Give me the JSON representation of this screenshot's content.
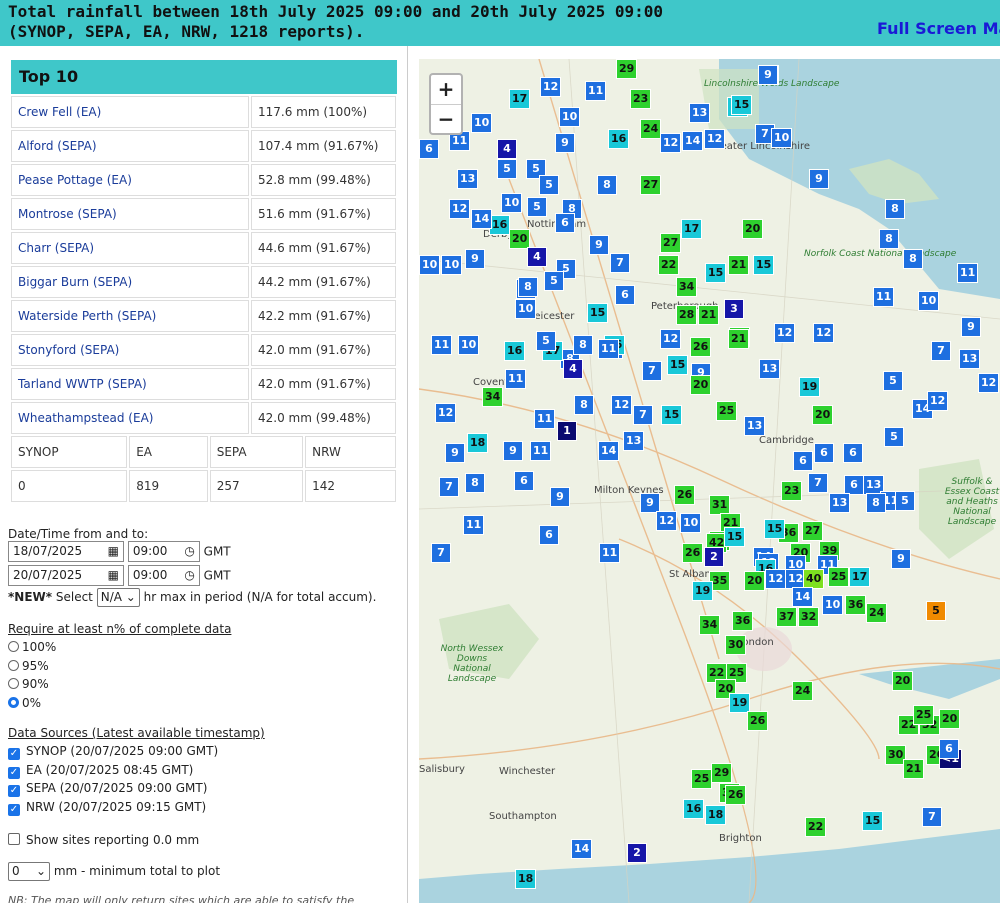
{
  "header": {
    "title_line1": "Total rainfall between 18th July 2025 09:00 and 20th July 2025 09:00",
    "title_line2": "(SYNOP, SEPA, EA, NRW, 1218 reports).",
    "full_screen": "Full Screen Ma"
  },
  "top10": {
    "heading": "Top 10",
    "rows": [
      {
        "site": "Crew Fell (EA)",
        "value": "117.6 mm (100%)"
      },
      {
        "site": "Alford (SEPA)",
        "value": "107.4 mm (91.67%)"
      },
      {
        "site": "Pease Pottage (EA)",
        "value": "52.8 mm (99.48%)"
      },
      {
        "site": "Montrose (SEPA)",
        "value": "51.6 mm (91.67%)"
      },
      {
        "site": "Charr (SEPA)",
        "value": "44.6 mm (91.67%)"
      },
      {
        "site": "Biggar Burn (SEPA)",
        "value": "44.2 mm (91.67%)"
      },
      {
        "site": "Waterside Perth (SEPA)",
        "value": "42.2 mm (91.67%)"
      },
      {
        "site": "Stonyford (SEPA)",
        "value": "42.0 mm (91.67%)"
      },
      {
        "site": "Tarland WWTP (SEPA)",
        "value": "42.0 mm (91.67%)"
      },
      {
        "site": "Wheathampstead (EA)",
        "value": "42.0 mm (99.48%)"
      }
    ],
    "count_headers": [
      "SYNOP",
      "EA",
      "SEPA",
      "NRW"
    ],
    "count_values": [
      "0",
      "819",
      "257",
      "142"
    ]
  },
  "form": {
    "datetime_label": "Date/Time from and to:",
    "from_date": "18/07/2025",
    "from_time": "09:00",
    "to_date": "20/07/2025",
    "to_time": "09:00",
    "gmt": "GMT",
    "new_prefix": "*NEW*",
    "select_label": "Select",
    "hr_select": "N/A",
    "hr_suffix": "hr max in period (N/A for total accum).",
    "require_label": "Require at least n% of complete data",
    "radio_options": [
      "100%",
      "95%",
      "90%",
      "0%"
    ],
    "radio_selected": "0%",
    "sources_label": "Data Sources (Latest available timestamp)",
    "sources": [
      "SYNOP (20/07/2025 09:00 GMT)",
      "EA (20/07/2025 08:45 GMT)",
      "SEPA (20/07/2025 09:00 GMT)",
      "NRW (20/07/2025 09:15 GMT)"
    ],
    "show_zero_label": "Show sites reporting 0.0 mm",
    "min_total_select": "0",
    "min_total_label": "mm - minimum total to plot",
    "note_fragment": "NB: The map will only return sites which are able to satisfy the"
  },
  "map": {
    "zoom_in": "+",
    "zoom_out": "−",
    "places": [
      "Lincolnshire Wolds Landscape",
      "Greater Lincolnshire",
      "Nottingham",
      "Derby",
      "Leicester",
      "Peterborough",
      "Norfolk Coast National Landscape",
      "Coventry",
      "Cambridge",
      "Milton Keynes",
      "St Albans",
      "London",
      "North Wessex Downs National Landscape",
      "Salisbury",
      "Winchester",
      "Southampton",
      "Brighton",
      "Suffolk & Essex Coast and Heaths National Landscape"
    ],
    "colors": {
      "low": "#1e6fe0",
      "mid": "#1a9bd6",
      "cyan": "#19c8d8",
      "green": "#2ed12e",
      "lime": "#7ee020",
      "dark": "#1616a8",
      "orange": "#f08a00",
      "darkest": "#0a0a70"
    },
    "markers": [
      {
        "v": "29",
        "c": "green"
      },
      {
        "v": "9",
        "c": "low"
      },
      {
        "v": "17",
        "c": "cyan"
      },
      {
        "v": "12",
        "c": "low"
      },
      {
        "v": "11",
        "c": "low"
      },
      {
        "v": "23",
        "c": "green"
      },
      {
        "v": "13",
        "c": "low"
      },
      {
        "v": "15",
        "c": "cyan"
      },
      {
        "v": "9",
        "c": "low"
      },
      {
        "v": "10",
        "c": "low"
      },
      {
        "v": "10",
        "c": "low"
      },
      {
        "v": "24",
        "c": "green"
      },
      {
        "v": "12",
        "c": "low"
      },
      {
        "v": "15",
        "c": "cyan"
      },
      {
        "v": "7",
        "c": "low"
      },
      {
        "v": "10",
        "c": "low"
      },
      {
        "v": "6",
        "c": "low"
      },
      {
        "v": "11",
        "c": "low"
      },
      {
        "v": "4",
        "c": "dark"
      },
      {
        "v": "9",
        "c": "low"
      },
      {
        "v": "16",
        "c": "cyan"
      },
      {
        "v": "14",
        "c": "low"
      },
      {
        "v": "12",
        "c": "low"
      },
      {
        "v": "5",
        "c": "low"
      },
      {
        "v": "5",
        "c": "low"
      },
      {
        "v": "13",
        "c": "low"
      },
      {
        "v": "5",
        "c": "low"
      },
      {
        "v": "8",
        "c": "low"
      },
      {
        "v": "27",
        "c": "green"
      },
      {
        "v": "9",
        "c": "low"
      },
      {
        "v": "12",
        "c": "low"
      },
      {
        "v": "10",
        "c": "low"
      },
      {
        "v": "5",
        "c": "low"
      },
      {
        "v": "8",
        "c": "low"
      },
      {
        "v": "16",
        "c": "cyan"
      },
      {
        "v": "14",
        "c": "low"
      },
      {
        "v": "6",
        "c": "low"
      },
      {
        "v": "20",
        "c": "green"
      },
      {
        "v": "17",
        "c": "cyan"
      },
      {
        "v": "20",
        "c": "green"
      },
      {
        "v": "8",
        "c": "low"
      },
      {
        "v": "9",
        "c": "low"
      },
      {
        "v": "8",
        "c": "low"
      },
      {
        "v": "27",
        "c": "green"
      },
      {
        "v": "10",
        "c": "low"
      },
      {
        "v": "10",
        "c": "low"
      },
      {
        "v": "9",
        "c": "low"
      },
      {
        "v": "4",
        "c": "dark"
      },
      {
        "v": "5",
        "c": "low"
      },
      {
        "v": "7",
        "c": "low"
      },
      {
        "v": "22",
        "c": "green"
      },
      {
        "v": "15",
        "c": "cyan"
      },
      {
        "v": "21",
        "c": "green"
      },
      {
        "v": "15",
        "c": "cyan"
      },
      {
        "v": "8",
        "c": "low"
      },
      {
        "v": "11",
        "c": "low"
      },
      {
        "v": "6",
        "c": "low"
      },
      {
        "v": "5",
        "c": "low"
      },
      {
        "v": "34",
        "c": "green"
      },
      {
        "v": "11",
        "c": "low"
      },
      {
        "v": "10",
        "c": "low"
      },
      {
        "v": "10",
        "c": "low"
      },
      {
        "v": "8",
        "c": "low"
      },
      {
        "v": "15",
        "c": "cyan"
      },
      {
        "v": "6",
        "c": "low"
      },
      {
        "v": "28",
        "c": "green"
      },
      {
        "v": "21",
        "c": "green"
      },
      {
        "v": "3",
        "c": "dark"
      },
      {
        "v": "9",
        "c": "low"
      },
      {
        "v": "7",
        "c": "low"
      },
      {
        "v": "8",
        "c": "low"
      },
      {
        "v": "6",
        "c": "low"
      },
      {
        "v": "28",
        "c": "green"
      },
      {
        "v": "12",
        "c": "low"
      },
      {
        "v": "12",
        "c": "low"
      },
      {
        "v": "11",
        "c": "low"
      },
      {
        "v": "10",
        "c": "low"
      },
      {
        "v": "16",
        "c": "cyan"
      },
      {
        "v": "17",
        "c": "cyan"
      },
      {
        "v": "5",
        "c": "low"
      },
      {
        "v": "8",
        "c": "low"
      },
      {
        "v": "16",
        "c": "cyan"
      },
      {
        "v": "12",
        "c": "low"
      },
      {
        "v": "26",
        "c": "green"
      },
      {
        "v": "21",
        "c": "green"
      },
      {
        "v": "13",
        "c": "low"
      },
      {
        "v": "4",
        "c": "dark"
      },
      {
        "v": "11",
        "c": "low"
      },
      {
        "v": "7",
        "c": "low"
      },
      {
        "v": "15",
        "c": "cyan"
      },
      {
        "v": "9",
        "c": "low"
      },
      {
        "v": "13",
        "c": "low"
      },
      {
        "v": "3",
        "c": "dark"
      },
      {
        "v": "34",
        "c": "green"
      },
      {
        "v": "11",
        "c": "low"
      },
      {
        "v": "20",
        "c": "green"
      },
      {
        "v": "19",
        "c": "cyan"
      },
      {
        "v": "5",
        "c": "low"
      },
      {
        "v": "12",
        "c": "low"
      },
      {
        "v": "14",
        "c": "low"
      },
      {
        "v": "12",
        "c": "low"
      },
      {
        "v": "8",
        "c": "low"
      },
      {
        "v": "12",
        "c": "low"
      },
      {
        "v": "7",
        "c": "low"
      },
      {
        "v": "15",
        "c": "cyan"
      },
      {
        "v": "25",
        "c": "green"
      },
      {
        "v": "20",
        "c": "green"
      },
      {
        "v": "11",
        "c": "low"
      },
      {
        "v": "1",
        "c": "darkest"
      },
      {
        "v": "13",
        "c": "low"
      },
      {
        "v": "6",
        "c": "low"
      },
      {
        "v": "5",
        "c": "low"
      },
      {
        "v": "12",
        "c": "low"
      },
      {
        "v": "18",
        "c": "cyan"
      },
      {
        "v": "9",
        "c": "low"
      },
      {
        "v": "9",
        "c": "low"
      },
      {
        "v": "11",
        "c": "low"
      },
      {
        "v": "14",
        "c": "low"
      },
      {
        "v": "13",
        "c": "low"
      },
      {
        "v": "6",
        "c": "low"
      },
      {
        "v": "6",
        "c": "low"
      },
      {
        "v": "7",
        "c": "low"
      },
      {
        "v": "8",
        "c": "low"
      },
      {
        "v": "6",
        "c": "low"
      },
      {
        "v": "7",
        "c": "low"
      },
      {
        "v": "6",
        "c": "low"
      },
      {
        "v": "13",
        "c": "low"
      },
      {
        "v": "11",
        "c": "low"
      },
      {
        "v": "9",
        "c": "low"
      },
      {
        "v": "9",
        "c": "low"
      },
      {
        "v": "26",
        "c": "green"
      },
      {
        "v": "23",
        "c": "green"
      },
      {
        "v": "13",
        "c": "low"
      },
      {
        "v": "5",
        "c": "low"
      },
      {
        "v": "31",
        "c": "green"
      },
      {
        "v": "21",
        "c": "green"
      },
      {
        "v": "26",
        "c": "green"
      },
      {
        "v": "10",
        "c": "low"
      },
      {
        "v": "12",
        "c": "low"
      },
      {
        "v": "36",
        "c": "green"
      },
      {
        "v": "27",
        "c": "green"
      },
      {
        "v": "15",
        "c": "cyan"
      },
      {
        "v": "20",
        "c": "green"
      },
      {
        "v": "7",
        "c": "low"
      },
      {
        "v": "6",
        "c": "low"
      },
      {
        "v": "11",
        "c": "low"
      },
      {
        "v": "42",
        "c": "green"
      },
      {
        "v": "2",
        "c": "dark"
      },
      {
        "v": "15",
        "c": "cyan"
      },
      {
        "v": "10",
        "c": "low"
      },
      {
        "v": "8",
        "c": "low"
      },
      {
        "v": "9",
        "c": "low"
      },
      {
        "v": "39",
        "c": "green"
      },
      {
        "v": "26",
        "c": "green"
      },
      {
        "v": "14",
        "c": "low"
      },
      {
        "v": "12",
        "c": "low"
      },
      {
        "v": "16",
        "c": "cyan"
      },
      {
        "v": "11",
        "c": "low"
      },
      {
        "v": "11",
        "c": "low"
      },
      {
        "v": "35",
        "c": "green"
      },
      {
        "v": "20",
        "c": "green"
      },
      {
        "v": "12",
        "c": "low"
      },
      {
        "v": "12",
        "c": "low"
      },
      {
        "v": "40",
        "c": "lime"
      },
      {
        "v": "25",
        "c": "green"
      },
      {
        "v": "17",
        "c": "cyan"
      },
      {
        "v": "19",
        "c": "cyan"
      },
      {
        "v": "14",
        "c": "low"
      },
      {
        "v": "10",
        "c": "low"
      },
      {
        "v": "36",
        "c": "green"
      },
      {
        "v": "34",
        "c": "green"
      },
      {
        "v": "36",
        "c": "green"
      },
      {
        "v": "37",
        "c": "green"
      },
      {
        "v": "32",
        "c": "green"
      },
      {
        "v": "24",
        "c": "green"
      },
      {
        "v": "5",
        "c": "orange"
      },
      {
        "v": "30",
        "c": "green"
      },
      {
        "v": "22",
        "c": "green"
      },
      {
        "v": "25",
        "c": "green"
      },
      {
        "v": "20",
        "c": "green"
      },
      {
        "v": "19",
        "c": "cyan"
      },
      {
        "v": "26",
        "c": "green"
      },
      {
        "v": "29",
        "c": "green"
      },
      {
        "v": "30",
        "c": "green"
      },
      {
        "v": "25",
        "c": "green"
      },
      {
        "v": "26",
        "c": "green"
      },
      {
        "v": "24",
        "c": "green"
      },
      {
        "v": "20",
        "c": "green"
      },
      {
        "v": "22",
        "c": "green"
      },
      {
        "v": "32",
        "c": "green"
      },
      {
        "v": "26",
        "c": "green"
      },
      {
        "v": "30",
        "c": "green"
      },
      {
        "v": "21",
        "c": "green"
      },
      {
        "v": "20",
        "c": "green"
      },
      {
        "v": "25",
        "c": "green"
      },
      {
        "v": "<1",
        "c": "darkest"
      },
      {
        "v": "16",
        "c": "cyan"
      },
      {
        "v": "18",
        "c": "cyan"
      },
      {
        "v": "22",
        "c": "green"
      },
      {
        "v": "15",
        "c": "cyan"
      },
      {
        "v": "7",
        "c": "low"
      },
      {
        "v": "6",
        "c": "low"
      },
      {
        "v": "2",
        "c": "dark"
      },
      {
        "v": "14",
        "c": "low"
      },
      {
        "v": "18",
        "c": "cyan"
      }
    ]
  }
}
